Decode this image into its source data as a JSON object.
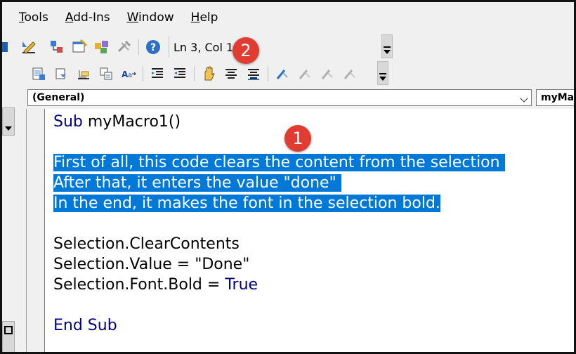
{
  "menu": {
    "items": [
      {
        "label": "Tools",
        "accel": "T"
      },
      {
        "label": "Add-Ins",
        "accel": "A"
      },
      {
        "label": "Window",
        "accel": "W"
      },
      {
        "label": "Help",
        "accel": "H"
      }
    ]
  },
  "toolbar": {
    "cursor_position": "Ln 3, Col 1"
  },
  "code_window": {
    "object_combo": "(General)",
    "procedure_combo": "myMa",
    "lines": {
      "sub_kw": "Sub",
      "sub_name": " myMacro1()",
      "comment1": "First of all, this code clears the content from the selection ",
      "comment2": "After that, it enters the value \"done\" ",
      "comment3": "In the end, it makes the font in the selection bold.",
      "code1": "Selection.ClearContents",
      "code2": "Selection.Value = \"Done\"",
      "code3_a": "Selection.Font.Bold = ",
      "code3_kw": "True",
      "end_sub": "End Sub"
    }
  },
  "badges": {
    "one": "1",
    "two": "2"
  },
  "colors": {
    "selection": "#0078d7",
    "keyword": "#00007f",
    "badge": "#e03c31"
  }
}
